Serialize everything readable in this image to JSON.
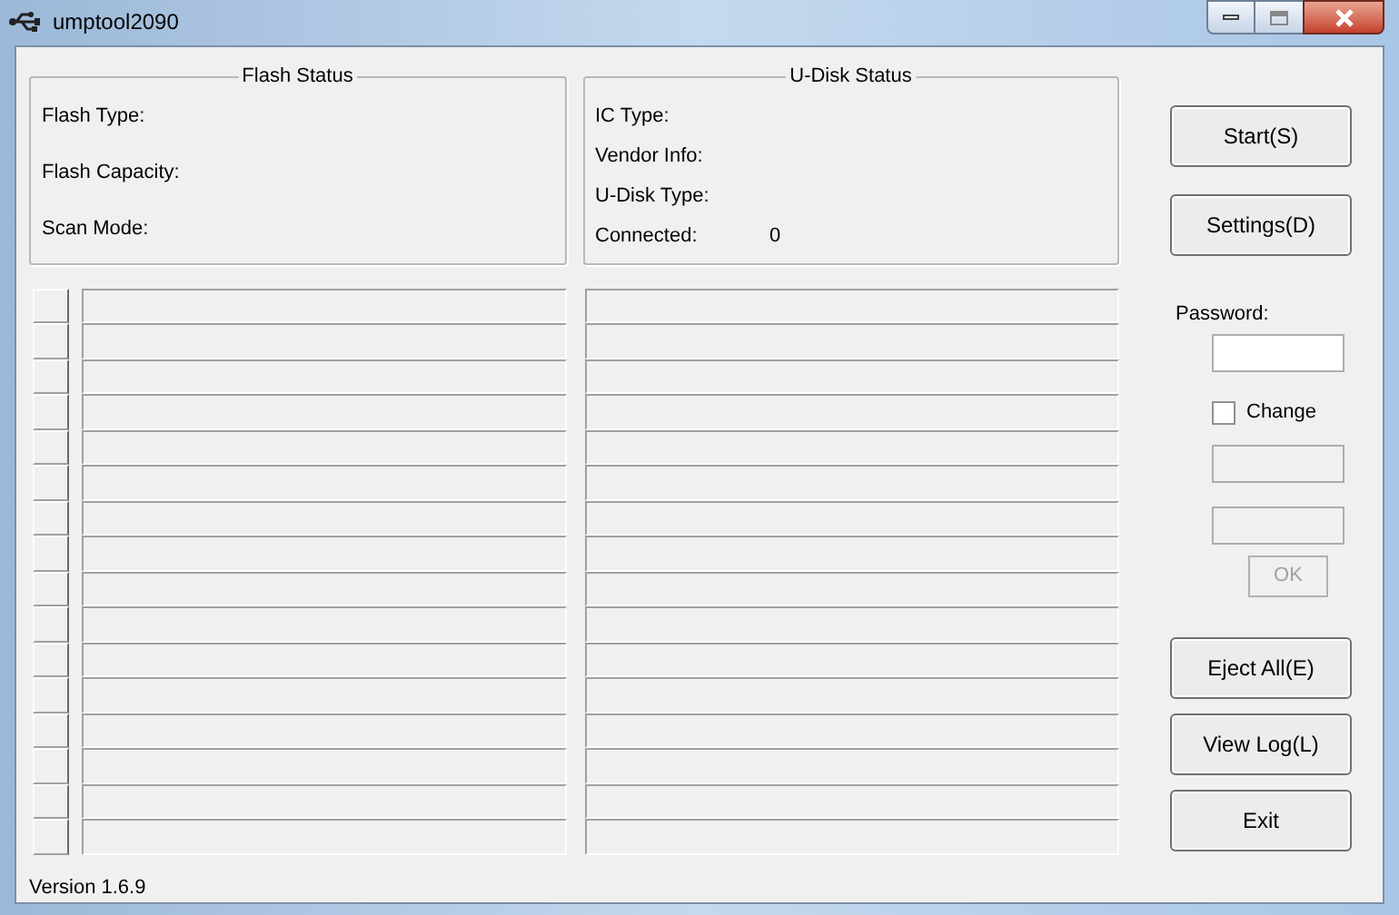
{
  "window": {
    "title": "umptool2090"
  },
  "flash_status": {
    "title": "Flash Status",
    "fields": [
      {
        "label": "Flash Type:"
      },
      {
        "label": "Flash Capacity:"
      },
      {
        "label": "Scan Mode:"
      }
    ]
  },
  "udisk_status": {
    "title": "U-Disk Status",
    "fields": [
      {
        "label": "IC Type:"
      },
      {
        "label": "Vendor Info:"
      },
      {
        "label": "U-Disk Type:"
      },
      {
        "label": "Connected:",
        "value": "0"
      }
    ]
  },
  "top_buttons": [
    {
      "label": "Start(S)"
    },
    {
      "label": "Settings(D)"
    }
  ],
  "password": {
    "label": "Password:"
  },
  "change": {
    "label": "Change",
    "checked": false
  },
  "new_password_fields": [
    {
      "disabled": true
    },
    {
      "disabled": true
    }
  ],
  "ok_button": {
    "label": "OK",
    "disabled": true
  },
  "bottom_buttons": [
    {
      "label": "Eject All(E)"
    },
    {
      "label": "View Log(L)"
    },
    {
      "label": "Exit"
    }
  ],
  "status_bar": {
    "version": "Version 1.6.9"
  }
}
